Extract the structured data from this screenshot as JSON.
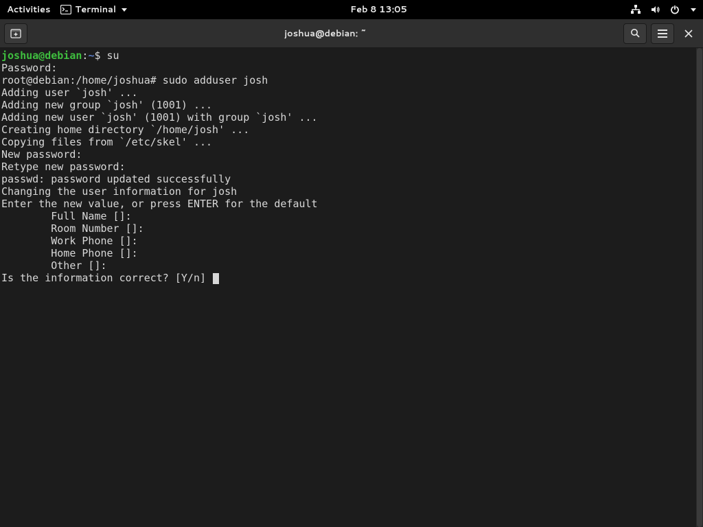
{
  "topbar": {
    "activities": "Activities",
    "app_name": "Terminal",
    "clock": "Feb 8  13:05"
  },
  "window": {
    "title": "joshua@debian: ~"
  },
  "term": {
    "p1_user": "joshua@debian",
    "p1_sep": ":",
    "p1_path": "~",
    "p1_dollar": "$ ",
    "p1_cmd": "su",
    "l_password": "Password:",
    "p2": "root@debian:/home/joshua# sudo adduser josh",
    "l_addinguser": "Adding user `josh' ...",
    "l_addinggroup": "Adding new group `josh' (1001) ...",
    "l_addingnewuser": "Adding new user `josh' (1001) with group `josh' ...",
    "l_creatinghome": "Creating home directory `/home/josh' ...",
    "l_copying": "Copying files from `/etc/skel' ...",
    "l_newpass": "New password:",
    "l_retype": "Retype new password:",
    "l_passwd": "passwd: password updated successfully",
    "l_changing": "Changing the user information for josh",
    "l_enternew": "Enter the new value, or press ENTER for the default",
    "l_fullname": "        Full Name []:",
    "l_room": "        Room Number []:",
    "l_work": "        Work Phone []:",
    "l_home": "        Home Phone []:",
    "l_other": "        Other []:",
    "l_correct": "Is the information correct? [Y/n] "
  }
}
